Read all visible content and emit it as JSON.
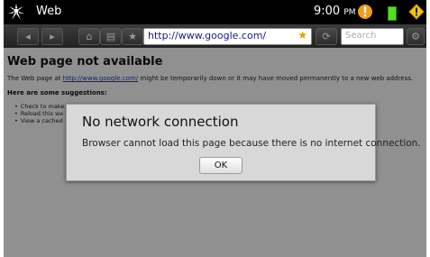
{
  "status_bar": {
    "app_name": "Web",
    "time": "9:00",
    "ampm": "PM"
  },
  "toolbar": {
    "back_icon": "back-arrow-icon",
    "forward_icon": "forward-arrow-icon",
    "url": "http://www.google.com/",
    "search_placeholder": "Search"
  },
  "page": {
    "title": "Web page not available",
    "message_prefix": "The Web page at ",
    "message_link": "http://www.google.com/",
    "message_suffix": " might be temporarily down or it may have moved permanently to a new web address.",
    "suggestions_heading": "Here are some suggestions:",
    "suggestions": [
      "Check to make",
      "Reload this we",
      "View a cached"
    ]
  },
  "dialog": {
    "title": "No network connection",
    "message": "Browser cannot load this page because there is no internet connection.",
    "ok_label": "OK"
  },
  "colors": {
    "link": "#1a35c9",
    "url_text": "#1a1a8a",
    "alert_orange": "#f29b1a",
    "battery_green": "#55dd22"
  }
}
